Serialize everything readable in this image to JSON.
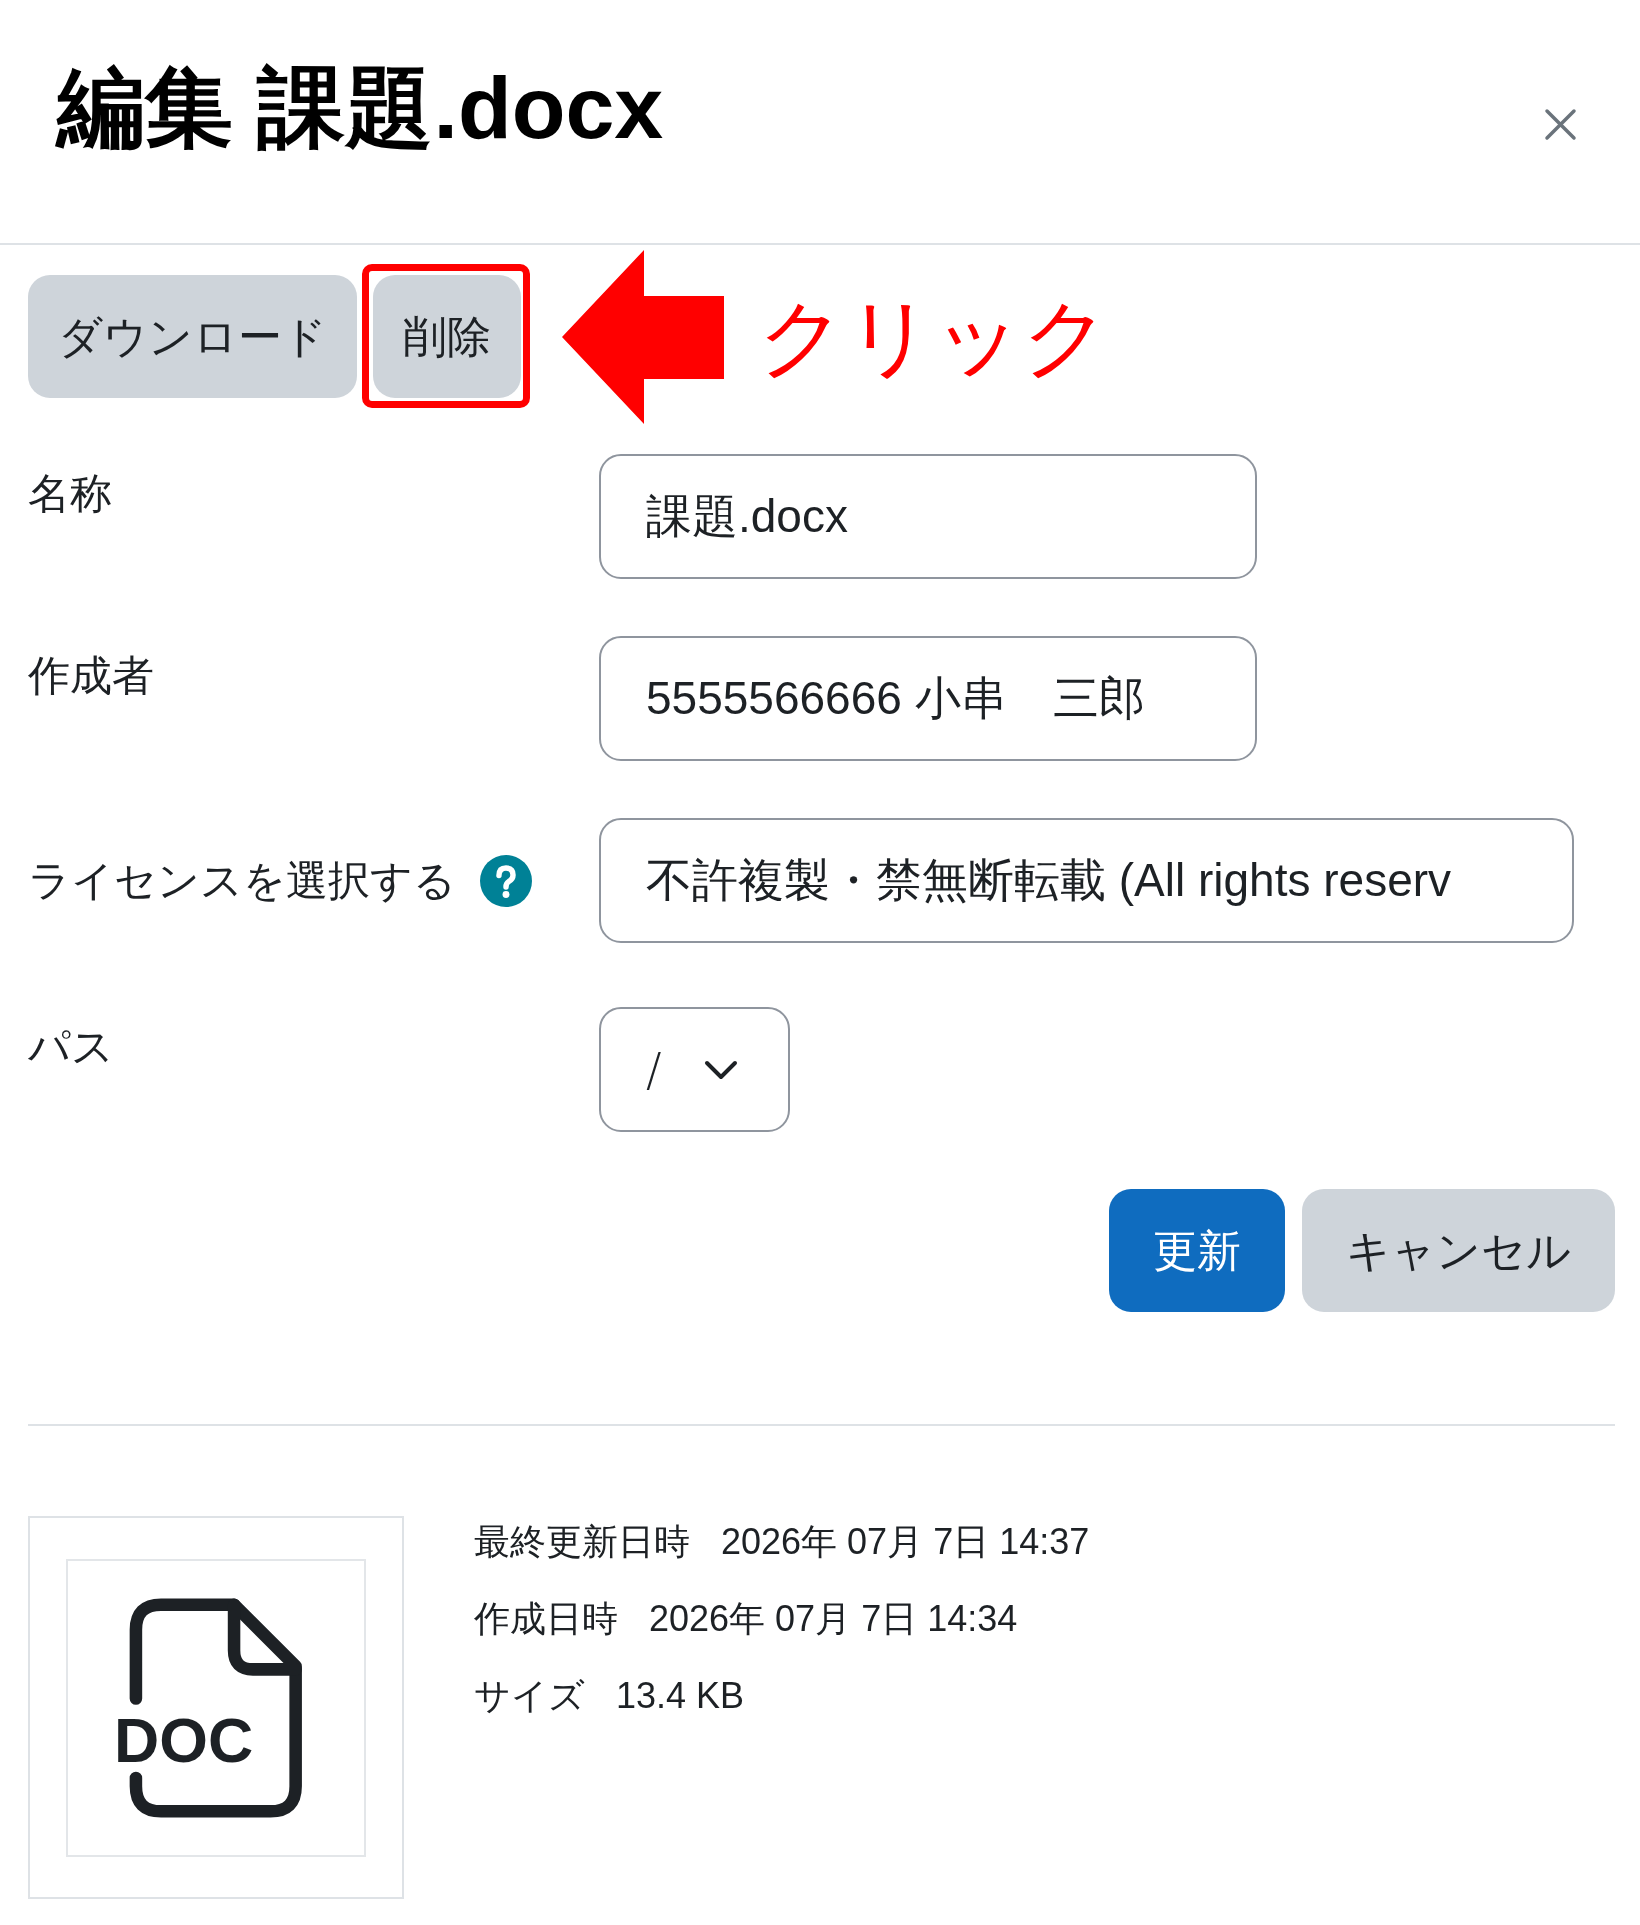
{
  "dialog": {
    "title": "編集 課題.docx"
  },
  "toolbar": {
    "buttons": [
      {
        "label": "ダウンロード",
        "highlighted": false
      },
      {
        "label": "削除",
        "highlighted": true
      }
    ]
  },
  "annotation": {
    "text": "クリック"
  },
  "form": {
    "fields": [
      {
        "label": "名称",
        "kind": "text",
        "value": "課題.docx"
      },
      {
        "label": "作成者",
        "kind": "text",
        "value": "5555566666 小串　三郎"
      },
      {
        "label": "ライセンスを選択する",
        "kind": "wide",
        "help": true,
        "value": "不許複製・禁無断転載 (All rights reserv"
      },
      {
        "label": "パス",
        "kind": "select",
        "value": "/"
      }
    ],
    "buttons": [
      {
        "label": "更新",
        "kind": "primary"
      },
      {
        "label": "キャンセル",
        "kind": "secondary"
      }
    ]
  },
  "file_info": {
    "icon_label": "DOC",
    "details": [
      {
        "label": "最終更新日時",
        "value": "2026年 07月 7日 14:37"
      },
      {
        "label": "作成日時",
        "value": "2026年 07月 7日 14:34"
      },
      {
        "label": "サイズ",
        "value": "13.4 KB"
      }
    ]
  }
}
